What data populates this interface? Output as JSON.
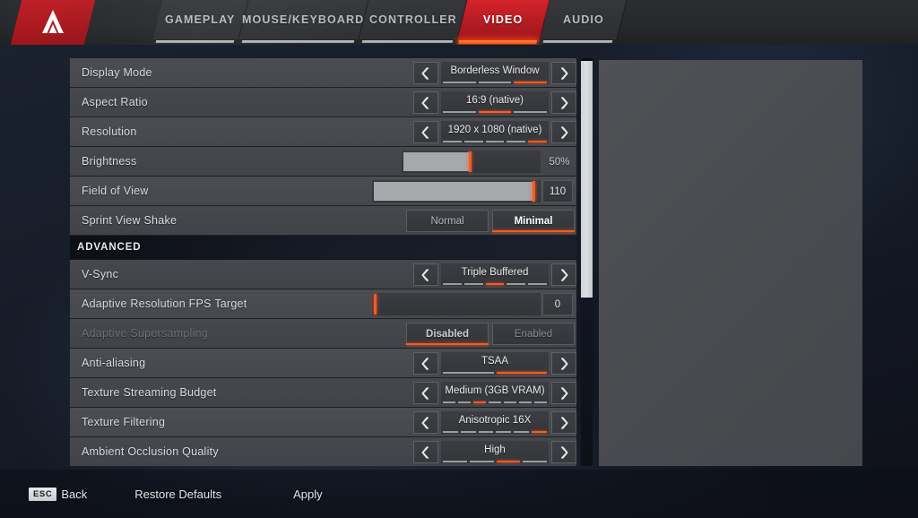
{
  "header": {
    "logo_icon": "apex-legends-logo",
    "tabs": [
      {
        "label": "GAMEPLAY",
        "active": false
      },
      {
        "label": "MOUSE/KEYBOARD",
        "active": false
      },
      {
        "label": "CONTROLLER",
        "active": false
      },
      {
        "label": "VIDEO",
        "active": true
      },
      {
        "label": "AUDIO",
        "active": false
      }
    ]
  },
  "settings": {
    "rows": [
      {
        "label": "Display Mode",
        "type": "selector",
        "value": "Borderless Window",
        "steps": 3,
        "index": 3,
        "disabled": false
      },
      {
        "label": "Aspect Ratio",
        "type": "selector",
        "value": "16:9 (native)",
        "steps": 3,
        "index": 2,
        "disabled": false
      },
      {
        "label": "Resolution",
        "type": "selector",
        "value": "1920 x 1080 (native)",
        "steps": 5,
        "index": 5,
        "disabled": false
      },
      {
        "label": "Brightness",
        "type": "slider",
        "value": "50%",
        "percent": 50,
        "boxed": false,
        "disabled": false
      },
      {
        "label": "Field of View",
        "type": "slider",
        "value": "110",
        "percent": 97,
        "boxed": true,
        "disabled": false
      },
      {
        "label": "Sprint View Shake",
        "type": "toggle",
        "options": [
          "Normal",
          "Minimal"
        ],
        "selected": 1,
        "disabled": false
      },
      {
        "label": "ADVANCED",
        "type": "section",
        "disabled": false
      },
      {
        "label": "V-Sync",
        "type": "selector",
        "value": "Triple Buffered",
        "steps": 5,
        "index": 3,
        "disabled": false
      },
      {
        "label": "Adaptive Resolution FPS Target",
        "type": "slider",
        "value": "0",
        "percent": 0,
        "boxed": true,
        "disabled": false
      },
      {
        "label": "Adaptive Supersampling",
        "type": "toggle",
        "options": [
          "Disabled",
          "Enabled"
        ],
        "selected": 0,
        "disabled": true
      },
      {
        "label": "Anti-aliasing",
        "type": "selector",
        "value": "TSAA",
        "steps": 2,
        "index": 2,
        "disabled": false
      },
      {
        "label": "Texture Streaming Budget",
        "type": "selector",
        "value": "Medium (3GB VRAM)",
        "steps": 7,
        "index": 3,
        "disabled": false
      },
      {
        "label": "Texture Filtering",
        "type": "selector",
        "value": "Anisotropic 16X",
        "steps": 6,
        "index": 6,
        "disabled": false
      },
      {
        "label": "Ambient Occlusion Quality",
        "type": "selector",
        "value": "High",
        "steps": 4,
        "index": 3,
        "disabled": false
      }
    ]
  },
  "scrollbar": {
    "thumb_top_pct": 0.7,
    "thumb_height_pct": 58
  },
  "footer": {
    "esc_key": "ESC",
    "back_label": "Back",
    "restore_label": "Restore Defaults",
    "apply_label": "Apply"
  },
  "colors": {
    "accent_orange": "#ff5a1f",
    "brand_red": "#c32027",
    "row_bg": "#4b4d52",
    "panel_gray": "#4a4c51"
  }
}
